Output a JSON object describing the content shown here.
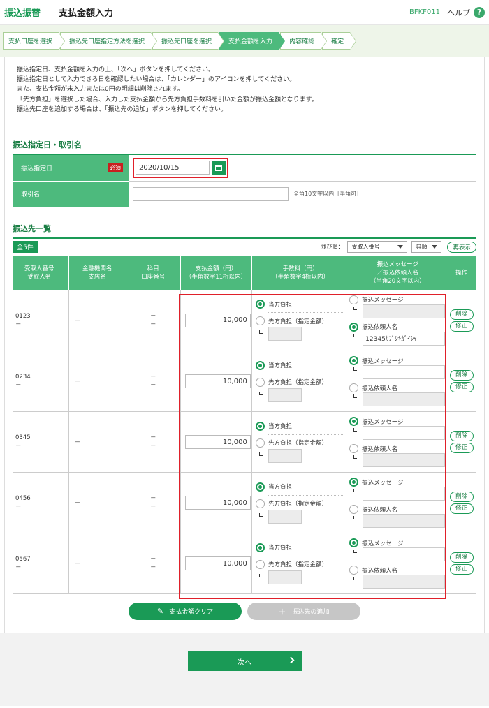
{
  "header": {
    "brand": "振込振替",
    "title": "支払金額入力",
    "screen_id": "BFKF011",
    "help_label": "ヘルプ",
    "help_icon": "?"
  },
  "steps": [
    "支払口座を選択",
    "振込先口座指定方法を選択",
    "振込先口座を選択",
    "支払金額を入力",
    "内容確認",
    "確定"
  ],
  "active_step": 3,
  "info_lines": [
    "振込指定日、支払金額を入力の上、「次へ」ボタンを押してください。",
    "振込指定日として入力できる日を確認したい場合は、「カレンダー」のアイコンを押してください。",
    "また、支払金額が未入力または0円の明細は削除されます。",
    "「先方負担」を選択した場合、入力した支払金額から先方負担手数料を引いた金額が振込金額となります。",
    "振込先口座を追加する場合は、「振込先の追加」ボタンを押してください。"
  ],
  "date_section": {
    "title": "振込指定日・取引名",
    "date_label": "振込指定日",
    "required": "必須",
    "date_value": "2020/10/15",
    "name_label": "取引名",
    "name_hint": "全角10文字以内［半角可］"
  },
  "list_section": {
    "title": "振込先一覧",
    "count": "全5件",
    "sort_label": "並び順：",
    "sort_value": "受取人番号",
    "order_value": "昇順",
    "redisplay": "再表示",
    "headers": {
      "col1": [
        "受取人番号",
        "受取人名"
      ],
      "col2": [
        "金融機関名",
        "支店名"
      ],
      "col3": [
        "科目",
        "口座番号"
      ],
      "col4": [
        "支払金額（円）",
        "（半角数字11桁以内）"
      ],
      "col5": [
        "手数料（円）",
        "（半角数字4桁以内）"
      ],
      "col6": [
        "振込メッセージ",
        "／振込依頼人名",
        "（半角20文字以内）"
      ],
      "col7": [
        "操作"
      ]
    },
    "fee_self": "当方負担",
    "fee_other": "先方負担（指定金額）",
    "msg_label": "振込メッセージ",
    "req_label": "振込依頼人名",
    "delete": "削除",
    "edit": "修正",
    "dash": "－",
    "rows": [
      {
        "num": "0123",
        "amount": "10,000",
        "msg_selected": false,
        "requester": "12345ｶﾌﾞｼｷｶﾞｲｼｬ"
      },
      {
        "num": "0234",
        "amount": "10,000",
        "msg_selected": true,
        "requester": ""
      },
      {
        "num": "0345",
        "amount": "10,000",
        "msg_selected": true,
        "requester": ""
      },
      {
        "num": "0456",
        "amount": "10,000",
        "msg_selected": true,
        "requester": ""
      },
      {
        "num": "0567",
        "amount": "10,000",
        "msg_selected": true,
        "requester": ""
      }
    ]
  },
  "buttons": {
    "clear": "支払金額クリア",
    "add": "振込先の追加",
    "next": "次へ"
  },
  "colors": {
    "primary": "#1a9a56",
    "header_green": "#4dba7d",
    "highlight_red": "#e0202a"
  }
}
